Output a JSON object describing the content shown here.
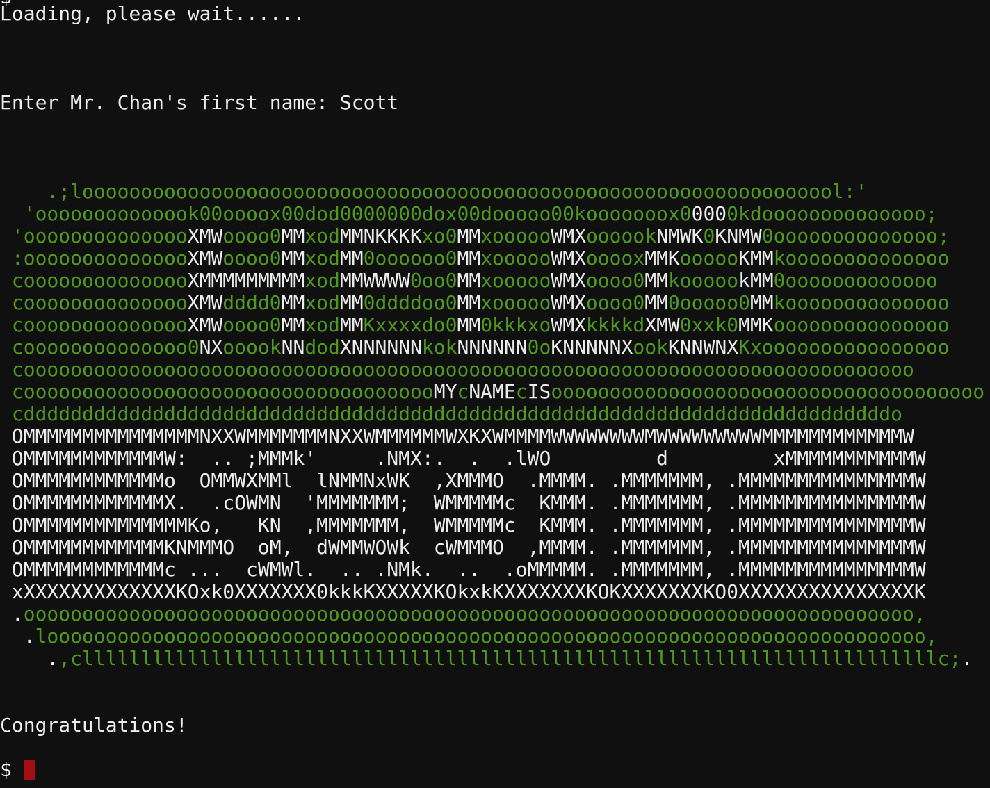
{
  "terminal": {
    "partial_top_line": "$",
    "loading_text": "Loading, please wait......",
    "input_prompt": "Enter Mr. Chan's first name: ",
    "input_value": "Scott",
    "result_text": "Congratulations!",
    "shell_prompt": "$",
    "colors": {
      "background": "#101010",
      "foreground": "#ececec",
      "green": "#4f9a1e",
      "cursor": "#a30d14"
    }
  },
  "art_rows": [
    [
      [
        "    .;",
        "g"
      ],
      [
        "looooooooooooooooooooooooooooooooooooooooooooooooooooooooooooooool:'",
        "g"
      ]
    ],
    [
      [
        "  'oooooooooooook00oooox00dod0000000dox00dooooo00kooooooox0",
        "g"
      ],
      [
        "000",
        "w"
      ],
      [
        "0kdoooooooooooooo;",
        "g"
      ]
    ],
    [
      [
        " 'oooooooooooooo",
        "g"
      ],
      [
        "XMW",
        "w"
      ],
      [
        "oooo0",
        "g"
      ],
      [
        "MM",
        "w"
      ],
      [
        "xod",
        "g"
      ],
      [
        "MMNKKKK",
        "w"
      ],
      [
        "xo0",
        "g"
      ],
      [
        "MM",
        "w"
      ],
      [
        "xooooo",
        "g"
      ],
      [
        "WMX",
        "w"
      ],
      [
        "oooook",
        "g"
      ],
      [
        "NMWK",
        "w"
      ],
      [
        "0",
        "g"
      ],
      [
        "KNMW",
        "w"
      ],
      [
        "0oooooooooooooo;",
        "g"
      ]
    ],
    [
      [
        " :oooooooooooooo",
        "g"
      ],
      [
        "XMW",
        "w"
      ],
      [
        "oooo0",
        "g"
      ],
      [
        "MM",
        "w"
      ],
      [
        "xod",
        "g"
      ],
      [
        "MM",
        "w"
      ],
      [
        "0oooooo0",
        "g"
      ],
      [
        "MM",
        "w"
      ],
      [
        "xooooo",
        "g"
      ],
      [
        "WMX",
        "w"
      ],
      [
        "oooox",
        "g"
      ],
      [
        "MMK",
        "w"
      ],
      [
        "ooooo",
        "g"
      ],
      [
        "KMM",
        "w"
      ],
      [
        "koooooooooooooo",
        "g"
      ]
    ],
    [
      [
        " coooooooooooooo",
        "g"
      ],
      [
        "XMMMMMMMMM",
        "w"
      ],
      [
        "xod",
        "g"
      ],
      [
        "MMWWWW",
        "w"
      ],
      [
        "0oo0",
        "g"
      ],
      [
        "MM",
        "w"
      ],
      [
        "xooooo",
        "g"
      ],
      [
        "WMX",
        "w"
      ],
      [
        "oooo0",
        "g"
      ],
      [
        "MM",
        "w"
      ],
      [
        "kooooo",
        "g"
      ],
      [
        "kMM",
        "w"
      ],
      [
        "0ooooooooooooo",
        "g"
      ]
    ],
    [
      [
        " coooooooooooooo",
        "g"
      ],
      [
        "XMW",
        "w"
      ],
      [
        "dddd0",
        "g"
      ],
      [
        "MM",
        "w"
      ],
      [
        "xod",
        "g"
      ],
      [
        "MM",
        "w"
      ],
      [
        "0ddddoo0",
        "g"
      ],
      [
        "MM",
        "w"
      ],
      [
        "xooooo",
        "g"
      ],
      [
        "WMX",
        "w"
      ],
      [
        "oooo0",
        "g"
      ],
      [
        "MM",
        "w"
      ],
      [
        "0ooooo0",
        "g"
      ],
      [
        "MM",
        "w"
      ],
      [
        "koooooooooooooo",
        "g"
      ]
    ],
    [
      [
        " coooooooooooooo",
        "g"
      ],
      [
        "XMW",
        "w"
      ],
      [
        "oooo0",
        "g"
      ],
      [
        "MM",
        "w"
      ],
      [
        "xod",
        "g"
      ],
      [
        "MM",
        "w"
      ],
      [
        "Kxxxxdo0",
        "g"
      ],
      [
        "MM",
        "w"
      ],
      [
        "0kkkxo",
        "g"
      ],
      [
        "WMX",
        "w"
      ],
      [
        "kkkkd",
        "g"
      ],
      [
        "XMW",
        "w"
      ],
      [
        "0xxk0",
        "g"
      ],
      [
        "MMK",
        "w"
      ],
      [
        "ooooooooooooooo",
        "g"
      ]
    ],
    [
      [
        " coooooooooooooo0",
        "g"
      ],
      [
        "NX",
        "w"
      ],
      [
        "ooook",
        "g"
      ],
      [
        "NN",
        "w"
      ],
      [
        "dod",
        "g"
      ],
      [
        "XNNNNNN",
        "w"
      ],
      [
        "kok",
        "g"
      ],
      [
        "NNNNNN",
        "w"
      ],
      [
        "0o",
        "g"
      ],
      [
        "KNNNNNX",
        "w"
      ],
      [
        "ook",
        "g"
      ],
      [
        "KNNWNX",
        "w"
      ],
      [
        "Kxoooooooooooooooo",
        "g"
      ]
    ],
    [
      [
        " coooooooooooooooooooooooooooooooooooooooooooooooooooooooooooooooooooooooooooo",
        "g"
      ]
    ],
    [
      [
        " cooooooooooooooooooooooooooooooooooo",
        "g"
      ],
      [
        "MY",
        "w"
      ],
      [
        "c",
        "g"
      ],
      [
        "NAME",
        "w"
      ],
      [
        "c",
        "g"
      ],
      [
        "IS",
        "w"
      ],
      [
        "ooooooooooooooooooooooooooooooooooooo",
        "g"
      ]
    ],
    [
      [
        " cddddddddddddddddddddddddddddddddddddddddddddddddddddddddddddddddddddddddddo",
        "g"
      ]
    ],
    [
      [
        " OMMMMMMMMMMMMMMMNXXWMMMMMMMNXXWMMMMMMWXKXWMMMMWWWWWWWWMWWWWWWWWWMMMMMMMMMMMMW",
        "w"
      ]
    ],
    [
      [
        " OMMMMMMMMMMMMW:  .. ;MMMk'     .NMX:.  .  .lWO         d         xMMMMMMMMMMMW",
        "w"
      ]
    ],
    [
      [
        " OMMMMMMMMMMMMo  OMMWXMMl  lNMMNxWK  ,XMMMO  .MMMM. .MMMMMMM, .MMMMMMMMMMMMMMMW",
        "w"
      ]
    ],
    [
      [
        " OMMMMMMMMMMMMX.  .cOWMN  'MMMMMMM;  WMMMMMc  KMMM. .MMMMMMM, .MMMMMMMMMMMMMMMW",
        "w"
      ]
    ],
    [
      [
        " OMMMMMMMMMMMMMMKo,   KN  ,MMMMMMM,  WMMMMMc  KMMM. .MMMMMMM, .MMMMMMMMMMMMMMMW",
        "w"
      ]
    ],
    [
      [
        " OMMMMMMMMMMMMKNMMMO  oM,  dWMMWOWk  cWMMMO  ,MMMM. .MMMMMMM, .MMMMMMMMMMMMMMMW",
        "w"
      ]
    ],
    [
      [
        " OMMMMMMMMMMMMc ...  cWMWl.  .. .NMk.  ..  .oMMMMM. .MMMMMMM, .MMMMMMMMMMMMMMMW",
        "w"
      ]
    ],
    [
      [
        " xXXXXXXXXXXXXXKOxk0XXXXXXX0kkkKXXXXXKOkxkKXXXXXXXKOKXXXXXXXKO0XXXXXXXXXXXXXXXK",
        "w"
      ]
    ],
    [
      [
        " .",
        "w"
      ],
      [
        "oooooooooooooooooooooooooooooooooooooooooooooooooooooooooooooooooooooooooooo,",
        "g"
      ]
    ],
    [
      [
        "  .",
        "w"
      ],
      [
        "looooooooooooooooooooooooooooooooooooooooooooooooooooooooooooooooooooooooooo,",
        "g"
      ]
    ],
    [
      [
        "    .",
        "w"
      ],
      [
        ",clllllllllllllllllllllllllllllllllllllllllllllllllllllllllllllllllllllllllc;",
        "g"
      ],
      [
        ".",
        "w"
      ]
    ]
  ]
}
